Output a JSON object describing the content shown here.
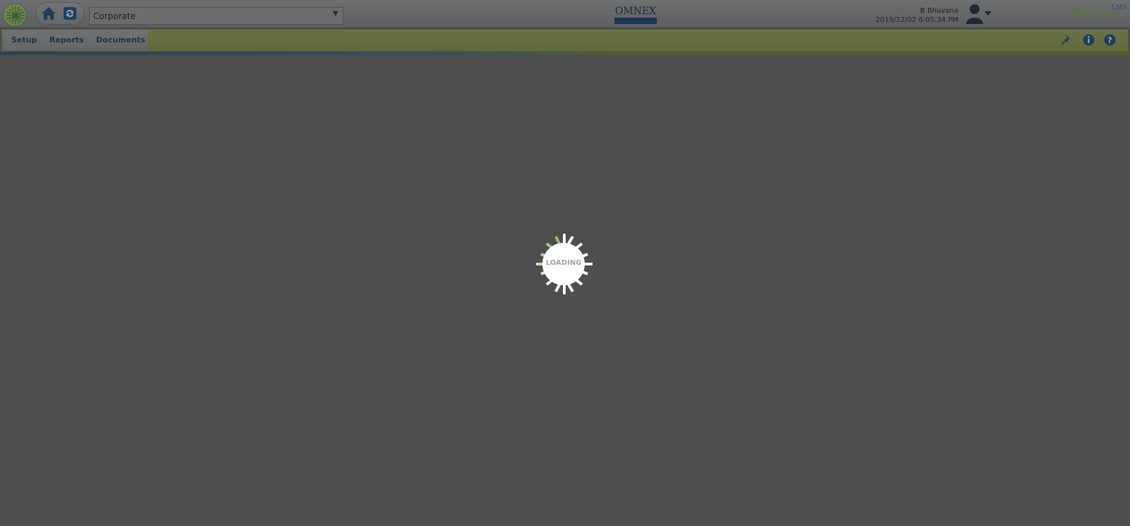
{
  "header": {
    "org_select": {
      "value": "Corporate",
      "caret": "▼"
    },
    "center_logo": {
      "text": "OMNEX"
    },
    "user": {
      "name": "B Bhuvana",
      "datetime": "2019/12/02 6:05:34 PM"
    },
    "right_logo": {
      "main": "Ew",
      "top": "LMS",
      "bottom": "QMS"
    }
  },
  "menu": {
    "items": [
      {
        "label": "Setup"
      },
      {
        "label": "Reports"
      },
      {
        "label": "Documents"
      }
    ]
  },
  "toolbar_icons": [
    "pin-icon",
    "info-icon",
    "help-icon"
  ],
  "loading": {
    "text": "LOADING"
  },
  "colors": {
    "overlay": "#4e4e4e",
    "accent_green": "#5a7a3a",
    "accent_blue": "#1d3557",
    "loader_green": "#8fbf6a"
  }
}
